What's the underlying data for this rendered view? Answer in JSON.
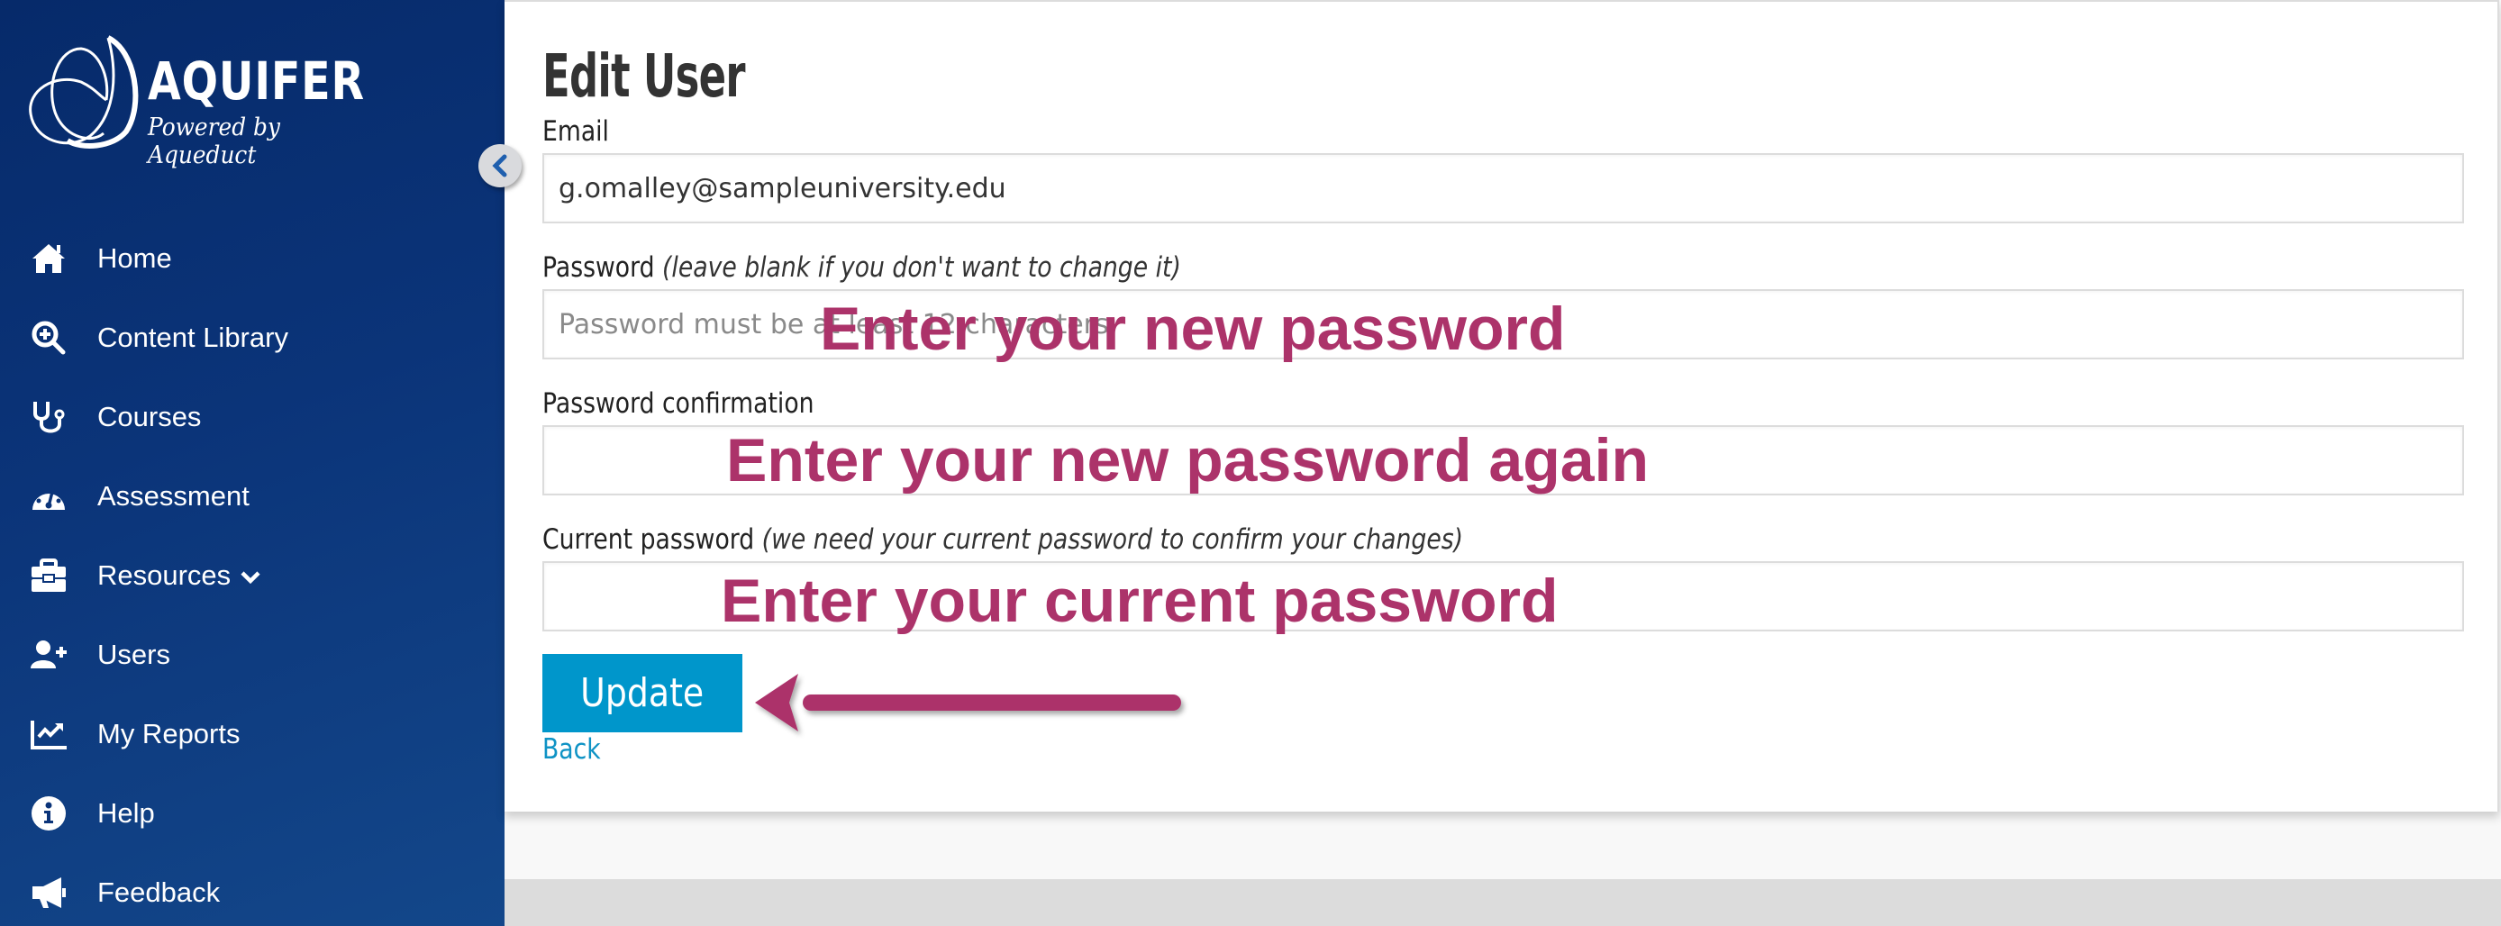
{
  "brand": {
    "name": "AQUIFER",
    "tagline": "Powered by Aqueduct",
    "logo_icon": "aquifer-swirl-logo"
  },
  "sidebar": {
    "collapse_icon": "chevron-left-icon",
    "items": [
      {
        "label": "Home",
        "icon": "home-icon"
      },
      {
        "label": "Content Library",
        "icon": "search-plus-icon"
      },
      {
        "label": "Courses",
        "icon": "stethoscope-icon"
      },
      {
        "label": "Assessment",
        "icon": "gauge-icon"
      },
      {
        "label": "Resources",
        "icon": "toolbox-icon",
        "has_dropdown": true
      },
      {
        "label": "Users",
        "icon": "user-plus-icon"
      },
      {
        "label": "My Reports",
        "icon": "chart-line-icon"
      },
      {
        "label": "Help",
        "icon": "info-circle-icon"
      },
      {
        "label": "Feedback",
        "icon": "megaphone-icon"
      }
    ]
  },
  "form": {
    "title": "Edit User",
    "email": {
      "label": "Email",
      "value": "g.omalley@sampleuniversity.edu"
    },
    "password": {
      "label": "Password",
      "hint": "(leave blank if you don't want to change it)",
      "placeholder": "Password must be at least 12 characters",
      "value": ""
    },
    "password_confirmation": {
      "label": "Password confirmation",
      "value": ""
    },
    "current_password": {
      "label": "Current password",
      "hint": "(we need your current password to confirm your changes)",
      "value": ""
    },
    "update_button": "Update",
    "back_link": "Back"
  },
  "annotations": {
    "new_password": "Enter your new password",
    "new_password_again": "Enter your new password again",
    "current_password": "Enter your current password",
    "arrow_target": "update-button"
  },
  "colors": {
    "sidebar_top": "#062a6a",
    "sidebar_bottom": "#13478a",
    "primary_button": "#0096cb",
    "link": "#0f93c5",
    "annotation": "#ac336a"
  }
}
